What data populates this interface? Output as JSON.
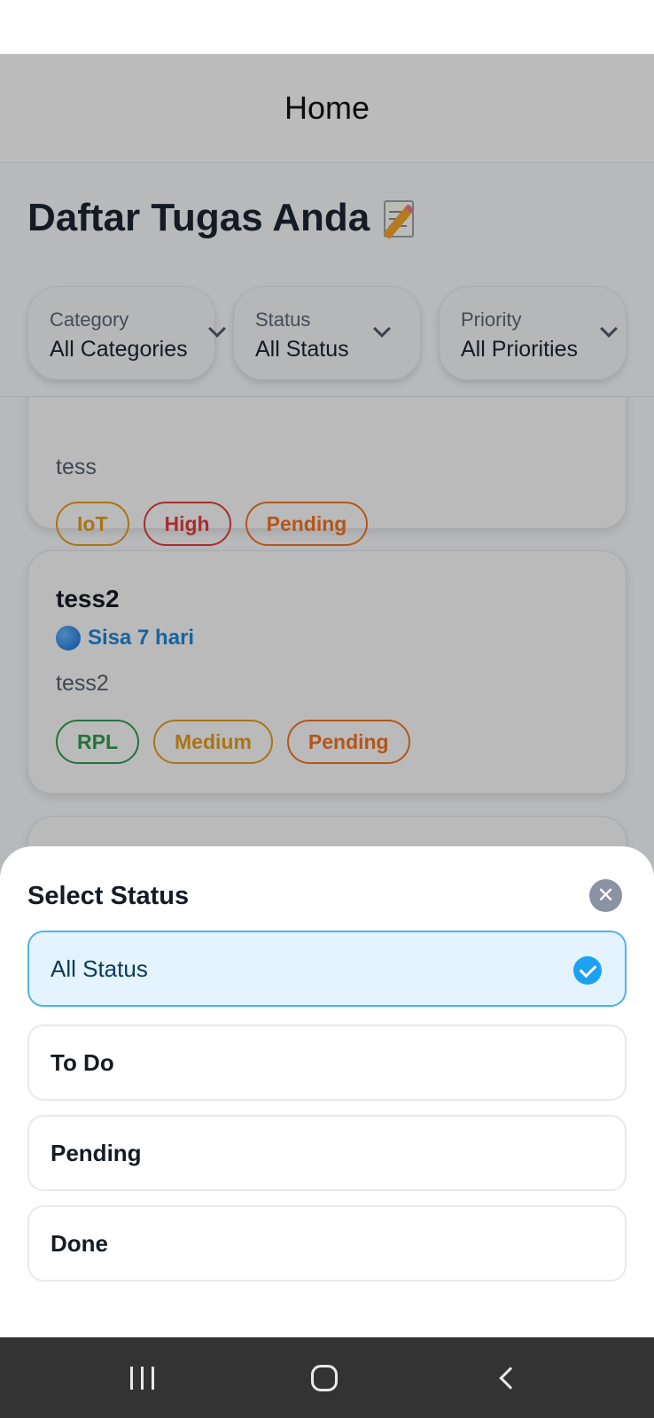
{
  "app": {
    "header_title": "Home",
    "page_heading": "Daftar Tugas Anda"
  },
  "filters": [
    {
      "label": "Category",
      "value": "All Categories"
    },
    {
      "label": "Status",
      "value": "All Status"
    },
    {
      "label": "Priority",
      "value": "All Priorities"
    }
  ],
  "tasks": [
    {
      "description": "tess",
      "tags": [
        "IoT",
        "High",
        "Pending"
      ]
    },
    {
      "title": "tess2",
      "due": "Sisa 7 hari",
      "description": "tess2",
      "tags": [
        "RPL",
        "Medium",
        "Pending"
      ]
    }
  ],
  "status_sheet": {
    "title": "Select Status",
    "options": [
      {
        "label": "All Status",
        "selected": true
      },
      {
        "label": "To Do",
        "selected": false
      },
      {
        "label": "Pending",
        "selected": false
      },
      {
        "label": "Done",
        "selected": false
      }
    ]
  },
  "icons": {
    "heading_icon": "memo-icon",
    "due_icon": "blue-circle-icon",
    "close": "close-icon",
    "selected": "check-circle-icon",
    "nav": [
      "recents-icon",
      "home-icon",
      "back-icon"
    ]
  }
}
